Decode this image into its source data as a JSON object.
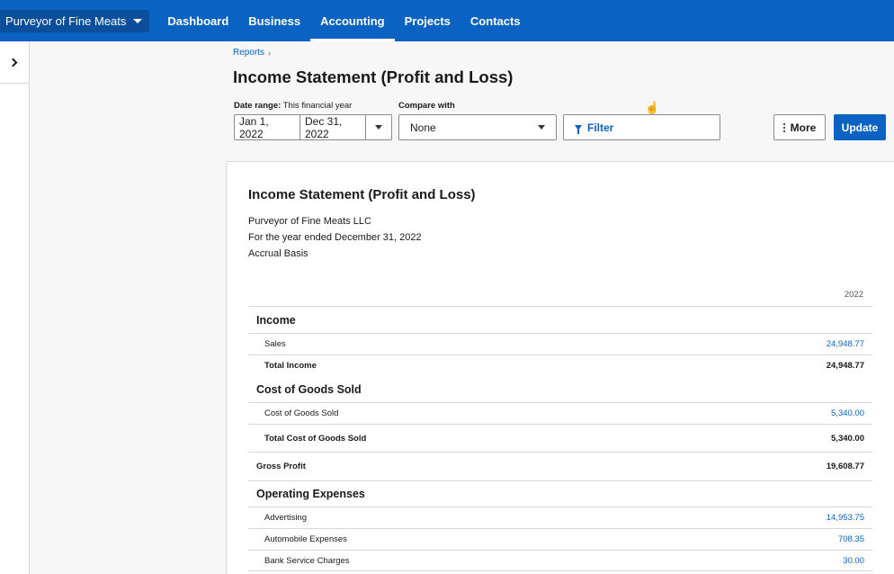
{
  "topnav": {
    "org_name": "Purveyor of Fine Meats",
    "tabs": [
      {
        "label": "Dashboard"
      },
      {
        "label": "Business"
      },
      {
        "label": "Accounting",
        "active": true
      },
      {
        "label": "Projects"
      },
      {
        "label": "Contacts"
      }
    ],
    "brand_color": "#0a62c3"
  },
  "breadcrumb": {
    "item": "Reports",
    "separator": "›"
  },
  "page_title": "Income Statement (Profit and Loss)",
  "filters": {
    "date_range_label": "Date range:",
    "date_range_value": "This financial year",
    "start_date": "Jan 1, 2022",
    "end_date": "Dec 31, 2022",
    "compare_label": "Compare with",
    "compare_value": "None",
    "filter_label": "Filter",
    "more_label": "More",
    "update_label": "Update"
  },
  "report": {
    "title": "Income Statement (Profit and Loss)",
    "company": "Purveyor of Fine Meats LLC",
    "period": "For the year ended December 31, 2022",
    "basis": "Accrual Basis",
    "column_header": "2022",
    "rows": [
      {
        "type": "section",
        "label": "Income",
        "value": ""
      },
      {
        "type": "item",
        "label": "Sales",
        "value": "24,948.77"
      },
      {
        "type": "total",
        "label": "Total Income",
        "value": "24,948.77"
      },
      {
        "type": "section",
        "label": "Cost of Goods Sold",
        "value": ""
      },
      {
        "type": "item",
        "label": "Cost of Goods Sold",
        "value": "5,340.00"
      },
      {
        "type": "total",
        "label": "Total Cost of Goods Sold",
        "value": "5,340.00"
      },
      {
        "type": "gross",
        "label": "Gross Profit",
        "value": "19,608.77"
      },
      {
        "type": "section",
        "label": "Operating Expenses",
        "value": ""
      },
      {
        "type": "item",
        "label": "Advertising",
        "value": "14,953.75"
      },
      {
        "type": "item",
        "label": "Automobile Expenses",
        "value": "708.35"
      },
      {
        "type": "item",
        "label": "Bank Service Charges",
        "value": "30.00"
      }
    ]
  }
}
